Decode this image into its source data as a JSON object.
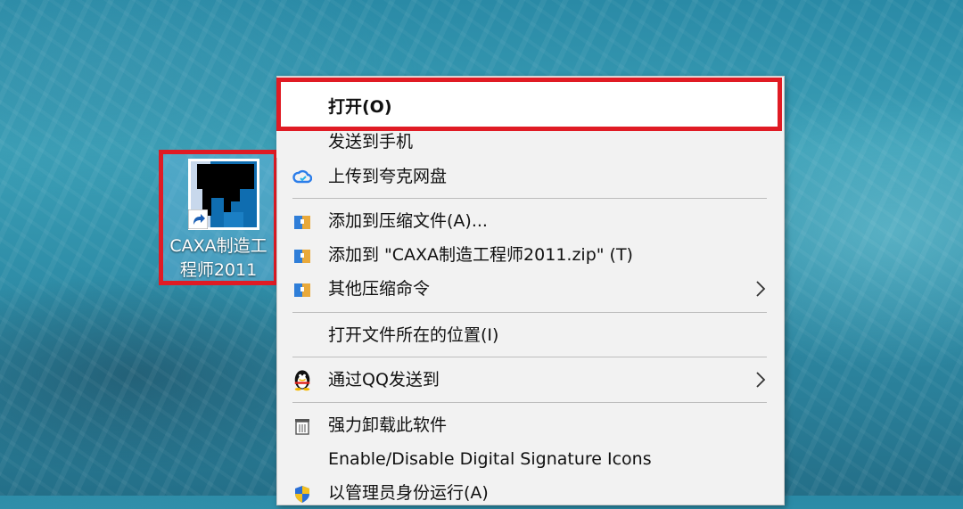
{
  "desktop": {
    "icon": {
      "name": "CAXA制造工程师2011",
      "icon": "caxa-app-icon",
      "shortcut": true
    }
  },
  "context_menu": {
    "items": [
      {
        "label": "打开(O)",
        "icon": null
      },
      {
        "label": "发送到手机",
        "icon": null
      },
      {
        "label": "上传到夸克网盘",
        "icon": "cloud-icon"
      },
      {
        "label": "添加到压缩文件(A)...",
        "icon": "archive-icon"
      },
      {
        "label": "添加到 \"CAXA制造工程师2011.zip\" (T)",
        "icon": "archive-icon"
      },
      {
        "label": "其他压缩命令",
        "icon": "archive-icon",
        "submenu": true
      },
      {
        "label": "打开文件所在的位置(I)",
        "icon": null
      },
      {
        "label": "通过QQ发送到",
        "icon": "qq-penguin-icon",
        "submenu": true
      },
      {
        "label": "强力卸载此软件",
        "icon": "trash-icon"
      },
      {
        "label": "Enable/Disable Digital Signature Icons",
        "icon": null
      },
      {
        "label": "以管理员身份运行(A)",
        "icon": "shield-icon"
      }
    ]
  },
  "colors": {
    "highlight_border": "#e01b24",
    "menu_bg": "#f2f2f2"
  }
}
